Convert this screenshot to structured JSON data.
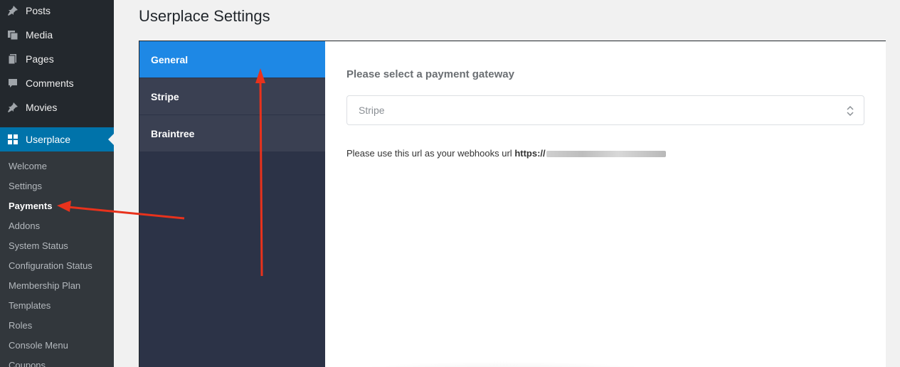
{
  "sidebar": {
    "menu": [
      {
        "label": "Posts",
        "icon": "pin-icon"
      },
      {
        "label": "Media",
        "icon": "media-icon"
      },
      {
        "label": "Pages",
        "icon": "pages-icon"
      },
      {
        "label": "Comments",
        "icon": "comment-icon"
      },
      {
        "label": "Movies",
        "icon": "pin-icon"
      },
      {
        "label": "Userplace",
        "icon": "grid-icon"
      }
    ],
    "submenu": [
      "Welcome",
      "Settings",
      "Payments",
      "Addons",
      "System Status",
      "Configuration Status",
      "Membership Plan",
      "Templates",
      "Roles",
      "Console Menu",
      "Coupons"
    ],
    "active_submenu": "Payments"
  },
  "page": {
    "title": "Userplace Settings"
  },
  "tabs": [
    "General",
    "Stripe",
    "Braintree"
  ],
  "active_tab": "General",
  "content": {
    "gateway_label": "Please select a payment gateway",
    "gateway_value": "Stripe",
    "webhook_text": "Please use this url as your webhooks url",
    "webhook_url_prefix": "https://"
  },
  "colors": {
    "sidebar_bg": "#23282d",
    "submenu_bg": "#32373c",
    "wp_accent": "#0073aa",
    "tab_active": "#1e88e5",
    "tab_panel": "#2c3347",
    "annotation_arrow": "#e8321c"
  }
}
